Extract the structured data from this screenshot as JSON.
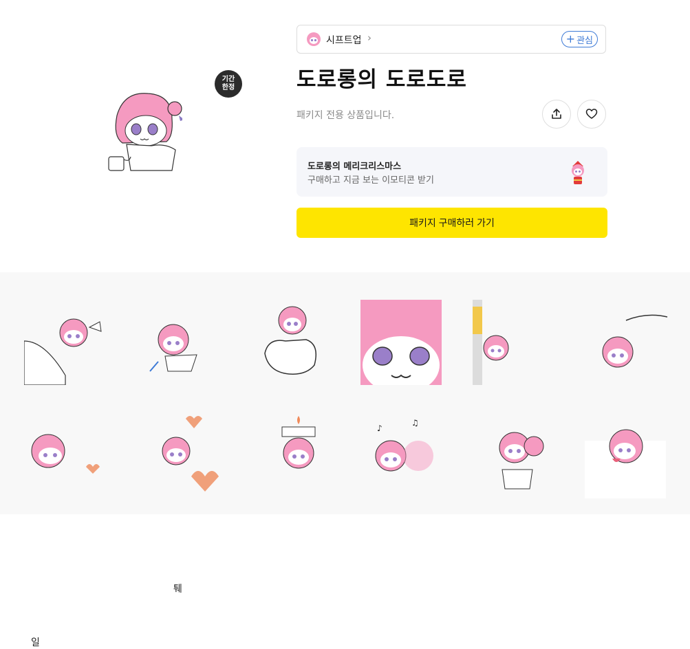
{
  "badge": {
    "line1": "기간",
    "line2": "한정"
  },
  "creator": {
    "name": "시프트업",
    "chevron": "›",
    "follow_label": "관심",
    "follow_icon": "+"
  },
  "title": "도로롱의 도로도로",
  "subtitle": "패키지 전용 상품입니다.",
  "actions": {
    "share_icon": "share-icon",
    "like_icon": "heart-icon"
  },
  "promo": {
    "title": "도로롱의 메리크리스마스",
    "desc": "구매하고 지금 보는 이모티콘 받기"
  },
  "buy_button": "패키지 구매하러 가기",
  "sticker_labels": {
    "s1": "일",
    "s2": "퉤"
  },
  "colors": {
    "accent_yellow": "#fee500",
    "follow_blue": "#3d7ad6",
    "hair_pink": "#f59ac0",
    "eye_purple": "#9a7fc9"
  },
  "stickers_count": 12
}
